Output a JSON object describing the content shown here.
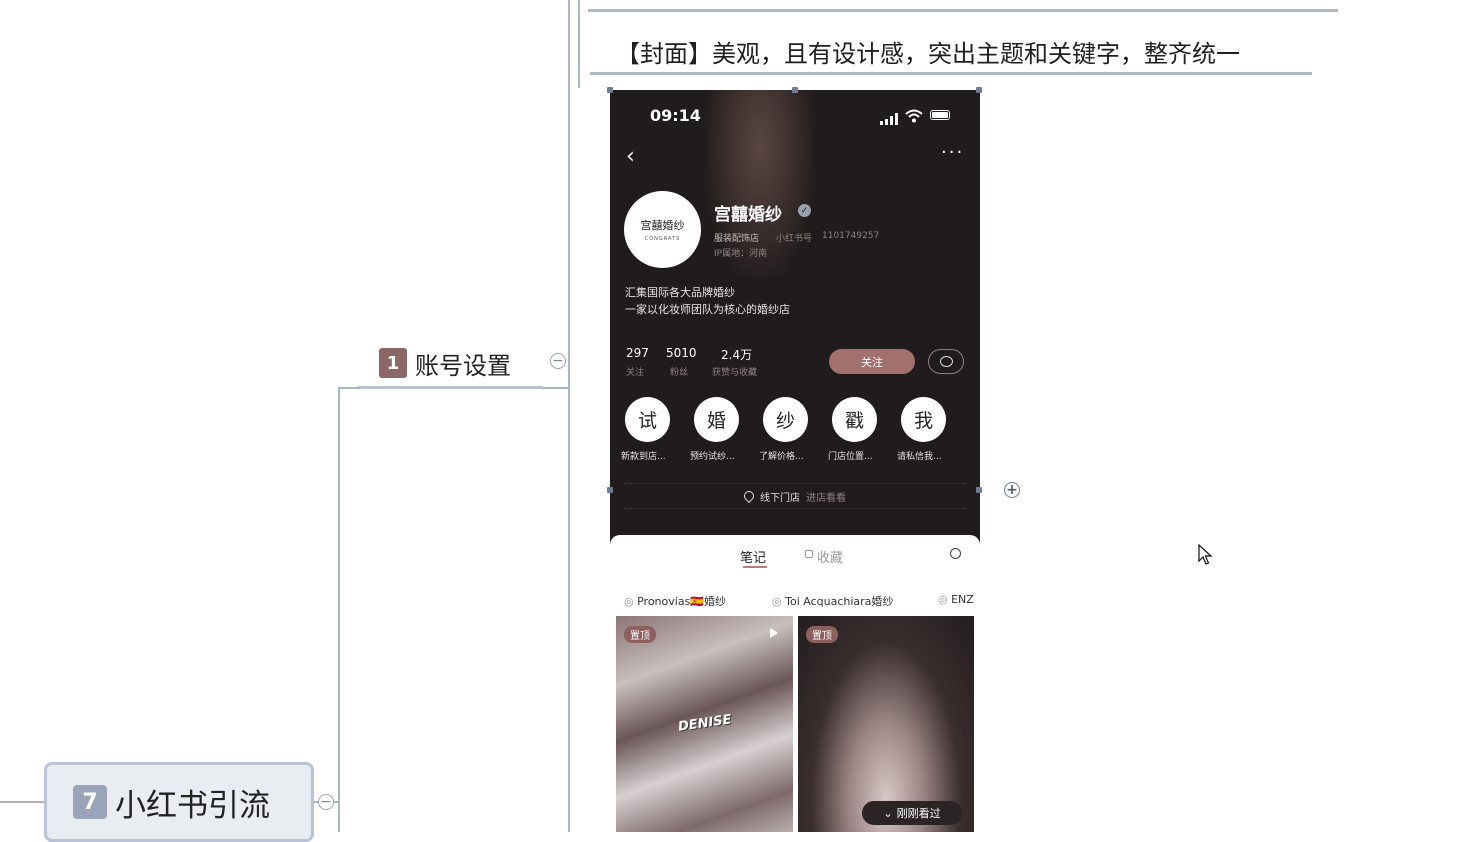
{
  "mindmap": {
    "node_account": {
      "number": "1",
      "label": "账号设置"
    },
    "node_traffic": {
      "number": "7",
      "label": "小红书引流"
    },
    "cover_note": "【封面】美观，且有设计感，突出主题和关键字，整齐统一",
    "collapse_symbol": "−",
    "expand_symbol": "+"
  },
  "phone": {
    "status_time": "09:14",
    "profile": {
      "name": "宫囍婚纱",
      "avatar_text": "宫囍婚纱",
      "avatar_sub": "CONGRATS",
      "category": "服装配饰店",
      "id_label": "小红书号",
      "id_value": "1101749257",
      "ip_label": "IP属地：河南",
      "bio_line1": "汇集国际各大品牌婚纱",
      "bio_line2": "一家以化妆师团队为核心的婚纱店"
    },
    "stats": [
      {
        "value": "297",
        "label": "关注"
      },
      {
        "value": "5010",
        "label": "粉丝"
      },
      {
        "value": "2.4万",
        "label": "获赞与收藏"
      }
    ],
    "follow_button": "关注",
    "highlights": [
      {
        "char": "试",
        "label": "新款到店..."
      },
      {
        "char": "婚",
        "label": "预约试纱..."
      },
      {
        "char": "纱",
        "label": "了解价格..."
      },
      {
        "char": "戳",
        "label": "门店位置..."
      },
      {
        "char": "我",
        "label": "请私信我..."
      }
    ],
    "store_label": "线下门店",
    "store_link": "进店看看",
    "tabs": {
      "notes": "笔记",
      "collections": "收藏"
    },
    "collections": [
      "Pronovias🇪🇸婚纱",
      "Toi Acquachiara婚纱",
      "ENZ"
    ],
    "posts": [
      {
        "tag": "置顶",
        "overlay": "DENISE"
      },
      {
        "tag": "置顶",
        "overlay": "刚刚看过"
      }
    ]
  }
}
